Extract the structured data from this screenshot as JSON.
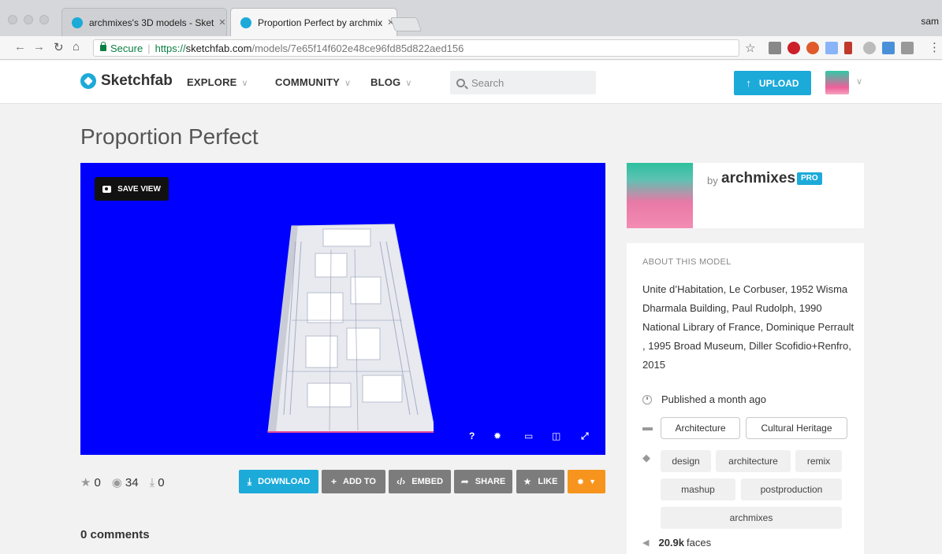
{
  "browser": {
    "tabs": [
      {
        "title": "archmixes's 3D models - Sket",
        "active": false
      },
      {
        "title": "Proportion Perfect by archmix",
        "active": true
      }
    ],
    "profile_name": "sam",
    "url": {
      "secure_label": "Secure",
      "protocol": "https://",
      "host": "sketchfab.com",
      "path": "/models/7e65f14f602e48ce96fd85d822aed156"
    }
  },
  "header": {
    "logo_text": "Sketchfab",
    "nav": [
      {
        "label": "EXPLORE"
      },
      {
        "label": "COMMUNITY"
      },
      {
        "label": "BLOG"
      }
    ],
    "search_placeholder": "Search",
    "upload_label": "UPLOAD"
  },
  "model": {
    "title": "Proportion Perfect",
    "save_view_label": "SAVE VIEW",
    "viewer_controls": [
      "?",
      "settings-icon",
      "vr-icon",
      "embed-view-icon",
      "fullscreen-icon"
    ],
    "stats": {
      "likes": "0",
      "views": "34",
      "downloads": "0"
    },
    "actions": [
      {
        "label": "DOWNLOAD",
        "color": "#1caad9"
      },
      {
        "label": "ADD TO",
        "color": "#7c7c7c"
      },
      {
        "label": "EMBED",
        "color": "#7c7c7c"
      },
      {
        "label": "SHARE",
        "color": "#7c7c7c"
      },
      {
        "label": "LIKE",
        "color": "#7c7c7c"
      }
    ],
    "settings_button_color": "#f7941d",
    "comments_label": "0 comments",
    "viewer_background": "#0000ff"
  },
  "author": {
    "by_label": "by",
    "name": "archmixes",
    "badge": "PRO"
  },
  "about": {
    "heading": "ABOUT THIS MODEL",
    "description": "Unite d’Habitation, Le Corbuser, 1952 Wisma Dharmala Building, Paul Rudolph, 1990 National Library of France, Dominique Perrault , 1995 Broad Museum, Diller Scofidio+Renfro, 2015",
    "published": "Published a month ago",
    "categories": [
      "Architecture",
      "Cultural Heritage"
    ],
    "tags": [
      "design",
      "architecture",
      "remix",
      "mashup",
      "postproduction",
      "archmixes"
    ],
    "faces_count": "20.9k",
    "faces_label": "faces"
  }
}
